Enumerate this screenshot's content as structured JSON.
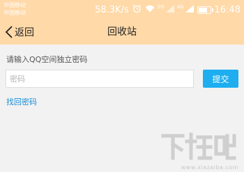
{
  "status_bar": {
    "carrier_1": "中国移动",
    "carrier_2": "中国移动",
    "net_speed": "58.3K/s",
    "signal_1_label": "2G",
    "signal_2_label": "4G",
    "time": "16:48",
    "battery_level": 0.7,
    "icons": [
      "alarm-icon",
      "wifi-icon",
      "signal-icon",
      "battery-icon"
    ]
  },
  "nav": {
    "back_label": "返回",
    "title": "回收站"
  },
  "form": {
    "prompt": "请输入QQ空间独立密码",
    "password_placeholder": "密码",
    "password_value": "",
    "submit_label": "提交",
    "recover_link": "找回密码"
  },
  "watermark": {
    "logo_text": "下载吧",
    "url": "www.xiazaiba.com"
  },
  "colors": {
    "header_bg": "#ffd9a8",
    "page_bg": "#f2f2f2",
    "accent": "#1eaef0",
    "link": "#1b8fd6"
  }
}
